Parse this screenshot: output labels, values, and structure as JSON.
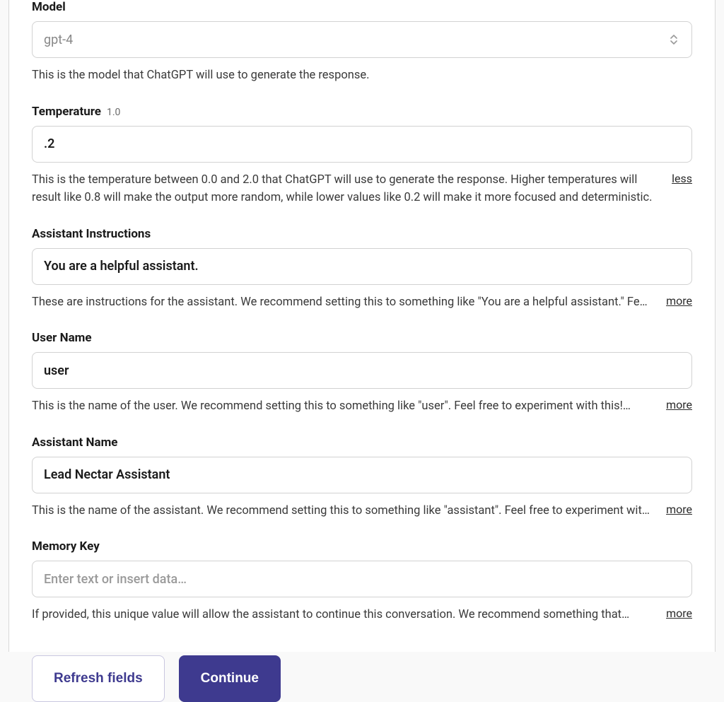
{
  "fields": {
    "model": {
      "label": "Model",
      "value": "gpt-4",
      "help": "This is the model that ChatGPT will use to generate the response."
    },
    "temperature": {
      "label": "Temperature",
      "suffix": "1.0",
      "value": ".2",
      "help": "This is the temperature between 0.0 and 2.0 that ChatGPT will use to generate the response. Higher temperatures will result like 0.8 will make the output more random, while lower values like 0.2 will make it more focused and deterministic.",
      "toggle": "less"
    },
    "assistant_instructions": {
      "label": "Assistant Instructions",
      "value": "You are a helpful assistant.",
      "help": "These are instructions for the assistant. We recommend setting this to something like \"You are a helpful assistant.\" Fe…",
      "toggle": "more"
    },
    "user_name": {
      "label": "User Name",
      "value": "user",
      "help": "This is the name of the user. We recommend setting this to something like \"user\". Feel free to experiment with this!…",
      "toggle": "more"
    },
    "assistant_name": {
      "label": "Assistant Name",
      "value": "Lead Nectar Assistant",
      "help": "This is the name of the assistant. We recommend setting this to something like \"assistant\". Feel free to experiment wit…",
      "toggle": "more"
    },
    "memory_key": {
      "label": "Memory Key",
      "placeholder": "Enter text or insert data…",
      "help": "If provided, this unique value will allow the assistant to continue this conversation. We recommend something that…",
      "toggle": "more"
    }
  },
  "buttons": {
    "refresh": "Refresh fields",
    "continue": "Continue"
  }
}
